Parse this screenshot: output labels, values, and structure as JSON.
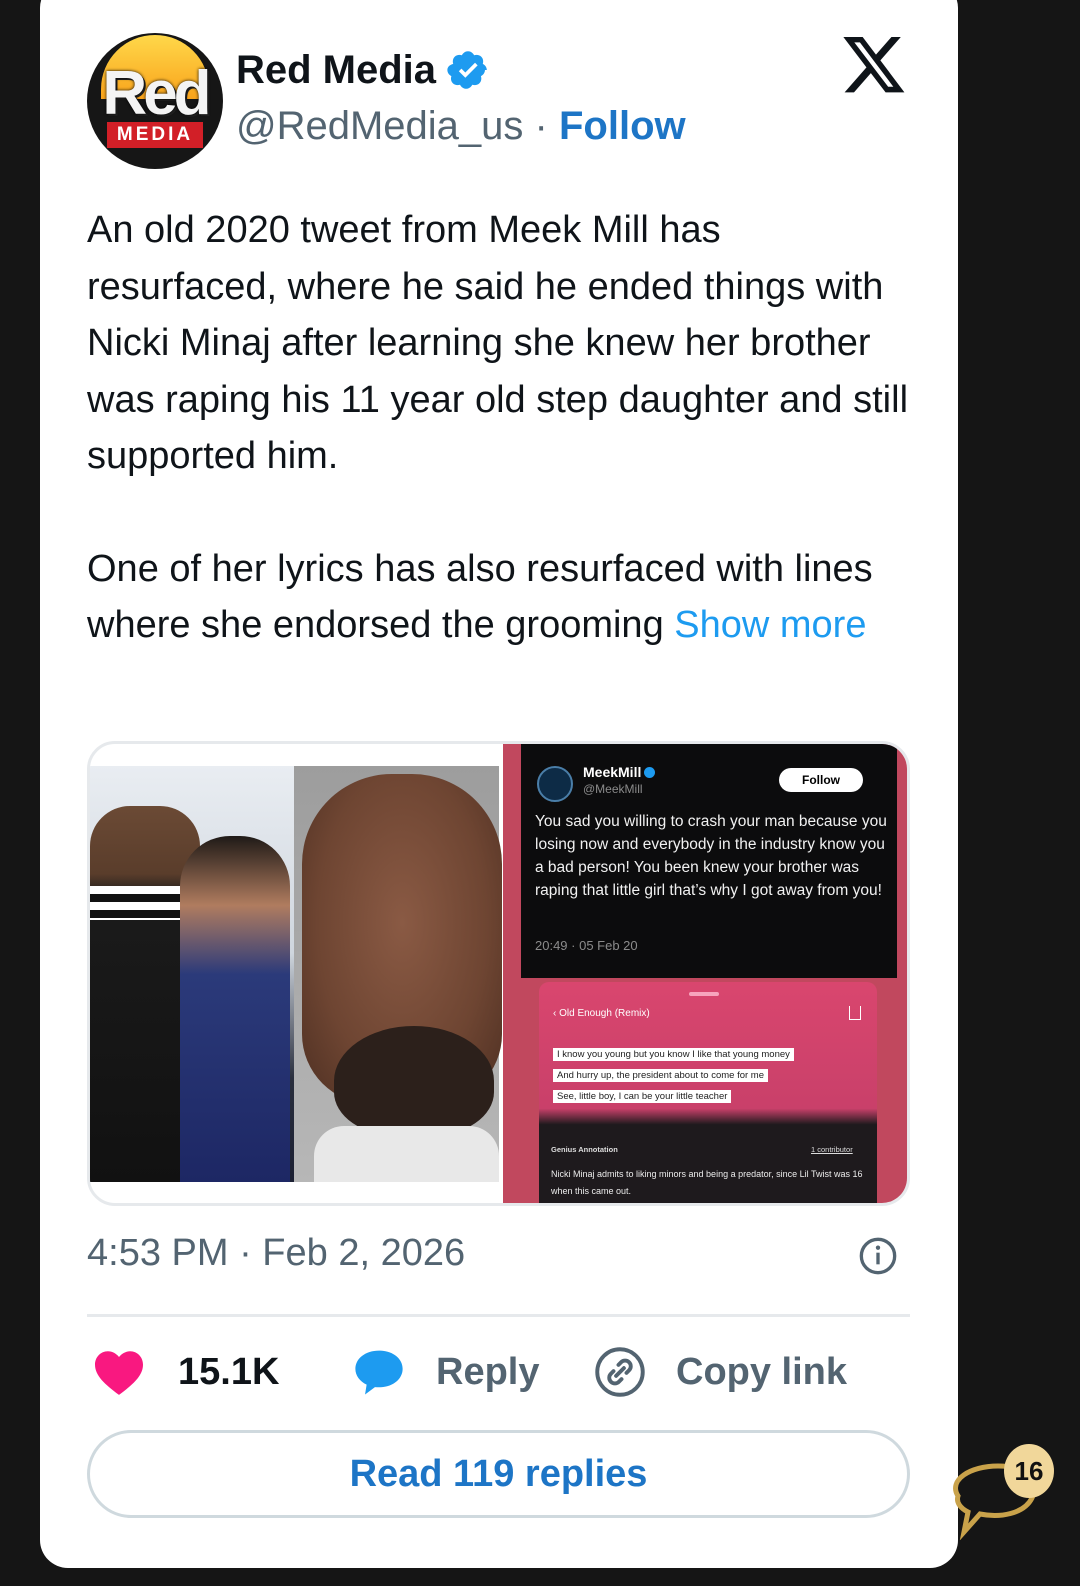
{
  "author": {
    "name": "Red Media",
    "handle": "@RedMedia_us",
    "separator": "·",
    "follow_label": "Follow",
    "avatar_text": "Red",
    "avatar_subtext": "MEDIA",
    "verified_icon": "verified-badge-icon"
  },
  "platform_icon": "x-logo-icon",
  "tweet": {
    "paragraph1": "An old 2020 tweet from Meek Mill has resurfaced, where he said he ended things with Nicki Minaj after learning she knew her brother was raping his 11 year old step daughter and still supported him.",
    "paragraph2": "One of her lyrics has also resurfaced with lines where she endorsed the grooming",
    "show_more": "Show more"
  },
  "embedded": {
    "tweet": {
      "name": "MeekMill",
      "handle": "@MeekMill",
      "follow_label": "Follow",
      "text": "You sad you willing to crash your man because you losing now and everybody in the industry know you a bad person! You been knew your brother was raping that little girl that’s why I got away from you!",
      "time": "20:49 · 05 Feb 20"
    },
    "genius": {
      "title": "Old Enough (Remix)",
      "lyrics": [
        "I know you young but you know I like that young money",
        "And hurry up, the president about to come for me",
        "See, little boy, I can be your little teacher"
      ],
      "annotation_label": "Genius Annotation",
      "contributor": "1 contributor",
      "annotation": "Nicki Minaj admits to liking minors and being a predator, since Lil Twist was 16 when this came out."
    }
  },
  "timestamp": "4:53 PM · Feb 2, 2026",
  "actions": {
    "likes": "15.1K",
    "reply_label": "Reply",
    "copy_label": "Copy link"
  },
  "read_replies": "Read 119 replies",
  "comment_badge_count": "16",
  "colors": {
    "link": "#1d75c6",
    "like": "#f91880",
    "reply_icon": "#1d9bf0",
    "badge": "#f1d79a"
  }
}
